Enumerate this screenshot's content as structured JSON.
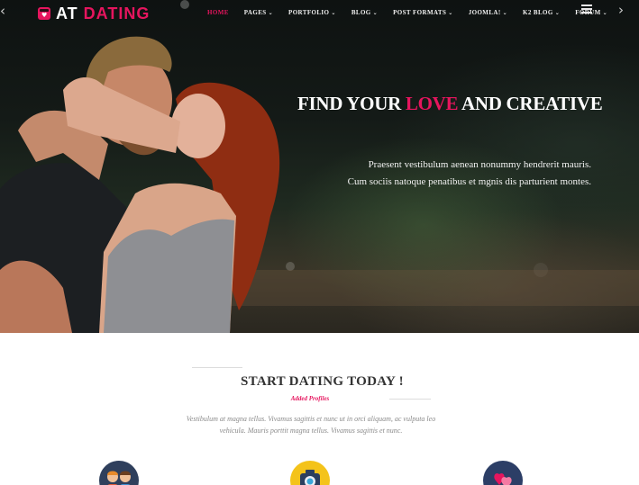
{
  "nav": {
    "logo_prefix": "AT",
    "logo_accent": "DATING",
    "items": [
      {
        "label": "HOME",
        "active": true,
        "dropdown": false
      },
      {
        "label": "PAGES",
        "active": false,
        "dropdown": true
      },
      {
        "label": "PORTFOLIO",
        "active": false,
        "dropdown": true
      },
      {
        "label": "BLOG",
        "active": false,
        "dropdown": true
      },
      {
        "label": "POST FORMATS",
        "active": false,
        "dropdown": true
      },
      {
        "label": "JOOMLA!",
        "active": false,
        "dropdown": true
      },
      {
        "label": "K2 BLOG",
        "active": false,
        "dropdown": true
      },
      {
        "label": "FORUM",
        "active": false,
        "dropdown": true
      }
    ],
    "menu_icon": "hamburger-menu-icon"
  },
  "hero": {
    "headline_part1": "FIND YOUR",
    "headline_accent": "LOVE",
    "headline_part2": "AND CREATIVE",
    "line1": "Praesent vestibulum aenean nonummy hendrerit mauris.",
    "line2": "Cum sociis natoque penatibus et mgnis dis parturient montes.",
    "prev_icon": "chevron-left-icon",
    "next_icon": "chevron-right-icon"
  },
  "section": {
    "title": "START DATING TODAY !",
    "subtitle": "Added Profiles",
    "body": "Vestibulum at magna tellus. Vivamus sagittis et nunc ut in orci aliquam, ac vulputa leo vehicula. Mauris porttit magna tellus. Vivamus sagittis et nunc."
  },
  "features": [
    {
      "icon": "couple-icon",
      "color": "#2f3f5c"
    },
    {
      "icon": "camera-icon",
      "color": "#f4c31a"
    },
    {
      "icon": "hearts-icon",
      "color": "#2c3e66"
    }
  ],
  "colors": {
    "accent": "#e6155e",
    "heading": "#333333",
    "body_text": "#8a8a8a"
  }
}
